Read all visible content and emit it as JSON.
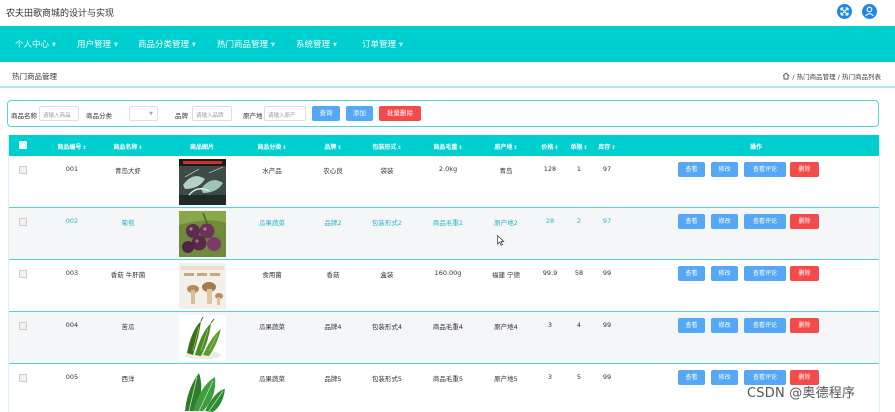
{
  "app": {
    "title": "农夫田歌商城的设计与实现"
  },
  "header_icons": [
    "fullscreen-icon",
    "user-avatar-icon"
  ],
  "nav": [
    {
      "label": "个人中心",
      "has_caret": true
    },
    {
      "label": "用户管理",
      "has_caret": true
    },
    {
      "label": "商品分类管理",
      "has_caret": true
    },
    {
      "label": "热门商品管理",
      "has_caret": true
    },
    {
      "label": "系统管理",
      "has_caret": true
    },
    {
      "label": "订单管理",
      "has_caret": true
    }
  ],
  "page": {
    "title": "热门商品管理",
    "breadcrumb": "/ 热门商品管理 / 热门商品列表"
  },
  "search": {
    "name_label": "商品名称",
    "name_placeholder": "请输入商品",
    "category_label": "商品分类",
    "category_value": "",
    "brand_label": "品牌",
    "brand_placeholder": "请输入品牌",
    "origin_label": "原产地",
    "origin_placeholder": "请输入原产",
    "query_button": "查询",
    "add_button": "添加",
    "batch_delete_button": "批量删除"
  },
  "table": {
    "columns": [
      "商品编号",
      "商品名称",
      "商品图片",
      "商品分类",
      "品牌",
      "包装形式",
      "商品毛重",
      "原产地",
      "价格",
      "单限",
      "库存",
      "操作"
    ],
    "sortable": [
      true,
      true,
      false,
      true,
      true,
      true,
      true,
      true,
      true,
      true,
      true,
      false
    ],
    "actions": [
      "查看",
      "修改",
      "查看评论",
      "删除"
    ],
    "rows": [
      {
        "id": "001",
        "name": "青岛大虾",
        "image": "shrimp",
        "category": "水产品",
        "brand": "农心良",
        "package": "袋装",
        "weight": "2.0kg",
        "origin": "青岛",
        "price": "128",
        "limit": "1",
        "stock": "97"
      },
      {
        "id": "002",
        "name": "葡萄",
        "image": "grapes",
        "category": "瓜果蔬菜",
        "brand": "品牌2",
        "package": "包装形式2",
        "weight": "商品毛重2",
        "origin": "原产地2",
        "price": "28",
        "limit": "2",
        "stock": "97"
      },
      {
        "id": "003",
        "name": "香菇 牛肝菌",
        "image": "mushroom",
        "category": "食用菌",
        "brand": "香菇",
        "package": "盒装",
        "weight": "160.00g",
        "origin": "福建 宁德",
        "price": "99.9",
        "limit": "58",
        "stock": "99"
      },
      {
        "id": "004",
        "name": "苦瓜",
        "image": "bittergourd",
        "category": "瓜果蔬菜",
        "brand": "品牌4",
        "package": "包装形式4",
        "weight": "商品毛重4",
        "origin": "原产地4",
        "price": "3",
        "limit": "4",
        "stock": "99"
      },
      {
        "id": "005",
        "name": "西洋",
        "image": "greens",
        "category": "瓜果蔬菜",
        "brand": "品牌5",
        "package": "包装形式5",
        "weight": "商品毛重5",
        "origin": "原产地5",
        "price": "3",
        "limit": "5",
        "stock": "99"
      }
    ]
  },
  "colors": {
    "nav": "#00cfcf",
    "header": "#00cfcf",
    "button_blue": "#54a8f5",
    "button_red": "#f44a4a",
    "tinted_row_text": "#27b6c8"
  },
  "watermark": "CSDN @奥德程序"
}
